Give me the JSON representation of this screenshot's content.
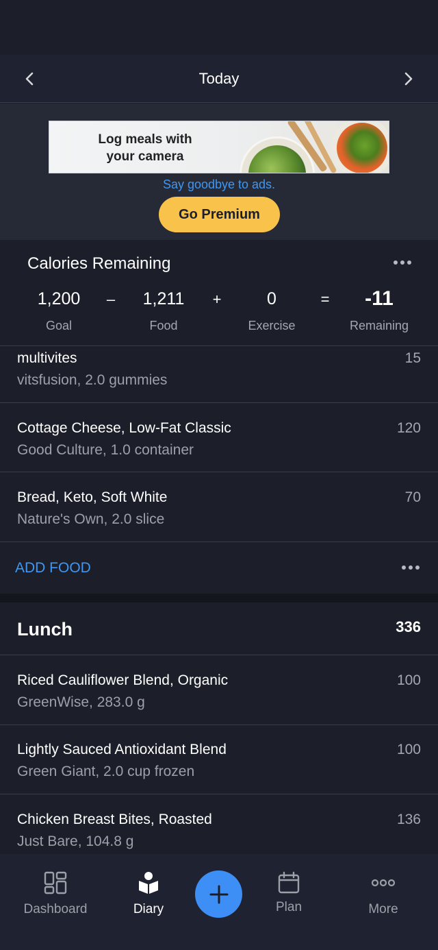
{
  "header": {
    "title": "Today"
  },
  "ad": {
    "headline_line1": "Log meals with",
    "headline_line2": "your camera",
    "tagline": "Say goodbye to ads.",
    "cta": "Go Premium"
  },
  "calories": {
    "title": "Calories Remaining",
    "goal": "1,200",
    "goal_label": "Goal",
    "minus": "–",
    "food": "1,211",
    "food_label": "Food",
    "plus": "+",
    "exercise": "0",
    "exercise_label": "Exercise",
    "equals": "=",
    "remaining": "-11",
    "remaining_label": "Remaining"
  },
  "breakfast_items": [
    {
      "name": "multivites",
      "detail": "vitsfusion, 2.0 gummies",
      "calories": "15"
    },
    {
      "name": "Cottage Cheese, Low-Fat Classic",
      "detail": "Good Culture, 1.0 container",
      "calories": "120"
    },
    {
      "name": "Bread, Keto, Soft White",
      "detail": "Nature's Own, 2.0 slice",
      "calories": "70"
    }
  ],
  "add_food_label": "ADD FOOD",
  "lunch": {
    "name": "Lunch",
    "total": "336",
    "items": [
      {
        "name": "Riced Cauliflower Blend, Organic",
        "detail": "GreenWise, 283.0 g",
        "calories": "100"
      },
      {
        "name": "Lightly Sauced Antioxidant Blend",
        "detail": "Green Giant, 2.0 cup frozen",
        "calories": "100"
      },
      {
        "name": "Chicken Breast Bites, Roasted",
        "detail": "Just Bare, 104.8 g",
        "calories": "136"
      }
    ]
  },
  "tabs": [
    {
      "label": "Dashboard",
      "icon": "dashboard-icon"
    },
    {
      "label": "Diary",
      "icon": "diary-icon"
    },
    {
      "label": "",
      "icon": "plus-icon"
    },
    {
      "label": "Plan",
      "icon": "calendar-icon"
    },
    {
      "label": "More",
      "icon": "more-icon"
    }
  ],
  "colors": {
    "accent": "#3d98f5",
    "premium": "#f8c24b",
    "background": "#1c1f2a"
  }
}
